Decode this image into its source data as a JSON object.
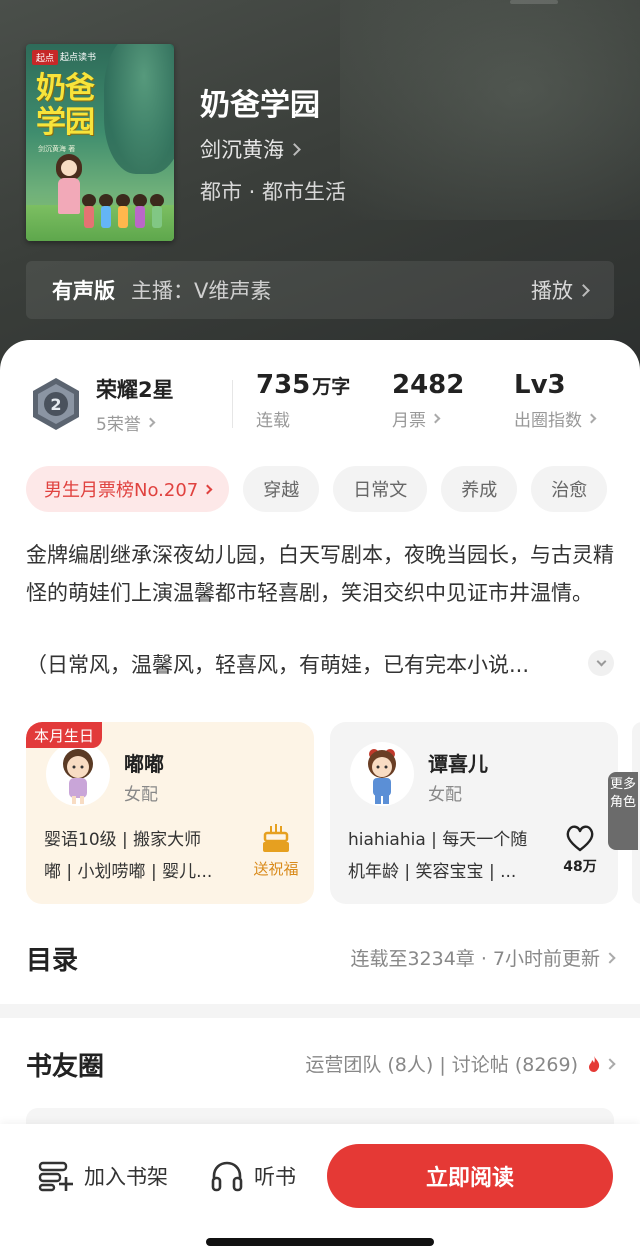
{
  "book": {
    "title": "奶爸学园",
    "author": "剑沉黄海",
    "genre": "都市 · 都市生活",
    "cover": {
      "publisher_badge": "起点",
      "publisher": "起点读书",
      "title": "奶爸学园",
      "author_line": "剑沉黄海 著"
    }
  },
  "audio": {
    "label": "有声版",
    "host": "主播：V维声素",
    "play_label": "播放"
  },
  "stats": {
    "honor": {
      "title": "荣耀2星",
      "sub": "5荣誉",
      "badge_number": "2"
    },
    "words": {
      "value": "735",
      "unit": "万字",
      "label": "连载"
    },
    "monthly_votes": {
      "value": "2482",
      "label": "月票"
    },
    "influence": {
      "value": "Lv3",
      "label": "出圈指数"
    }
  },
  "tags": {
    "rank": "男生月票榜No.207",
    "items": [
      "穿越",
      "日常文",
      "养成",
      "治愈"
    ]
  },
  "synopsis": {
    "text": "金牌编剧继承深夜幼儿园，白天写剧本，夜晚当园长，与古灵精怪的萌娃们上演温馨都市轻喜剧，笑泪交织中见证市井温情。",
    "more": "（日常风，温馨风，轻喜风，有萌娃，已有完本小说..."
  },
  "characters": [
    {
      "badge": "本月生日",
      "name": "嘟嘟",
      "role": "女配",
      "desc_line1": "婴语10级 | 搬家大师",
      "desc_line2": "嘟 | 小划唠嘟 | 婴儿...",
      "action_label": "送祝福"
    },
    {
      "name": "谭喜儿",
      "role": "女配",
      "desc_line1": "hiahiahia | 每天一个随",
      "desc_line2": "机年龄 | 笑容宝宝 | ...",
      "action_count": "48万"
    }
  ],
  "more_roles": "更多角色",
  "toc": {
    "title": "目录",
    "meta": "连载至3234章 · 7小时前更新"
  },
  "circle": {
    "title": "书友圈",
    "meta": "运营团队 (8人) | 讨论帖 (8269)"
  },
  "bottom_bar": {
    "shelf": "加入书架",
    "listen": "听书",
    "read": "立即阅读"
  },
  "colors": {
    "accent": "#e53935",
    "rank_bg": "#fde8e8",
    "birthday_card_bg": "#fdf4e6"
  }
}
